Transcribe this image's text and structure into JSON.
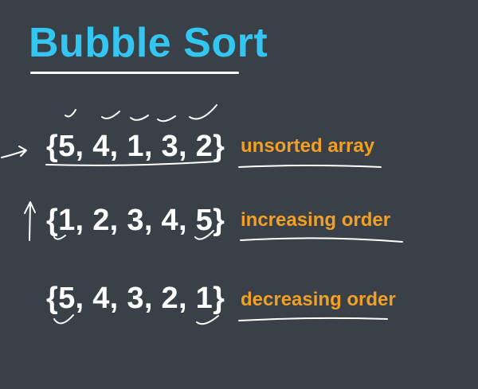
{
  "slide": {
    "title": "Bubble Sort",
    "rows": [
      {
        "array": "{5, 4, 1, 3, 2}",
        "label": "unsorted array"
      },
      {
        "array": "{1, 2, 3, 4, 5}",
        "label": "increasing order"
      },
      {
        "array": "{5, 4, 3, 2, 1}",
        "label": "decreasing order"
      }
    ]
  },
  "colors": {
    "background": "#3a4047",
    "title": "#33c6f0",
    "label": "#f2a024",
    "text": "#ffffff"
  }
}
